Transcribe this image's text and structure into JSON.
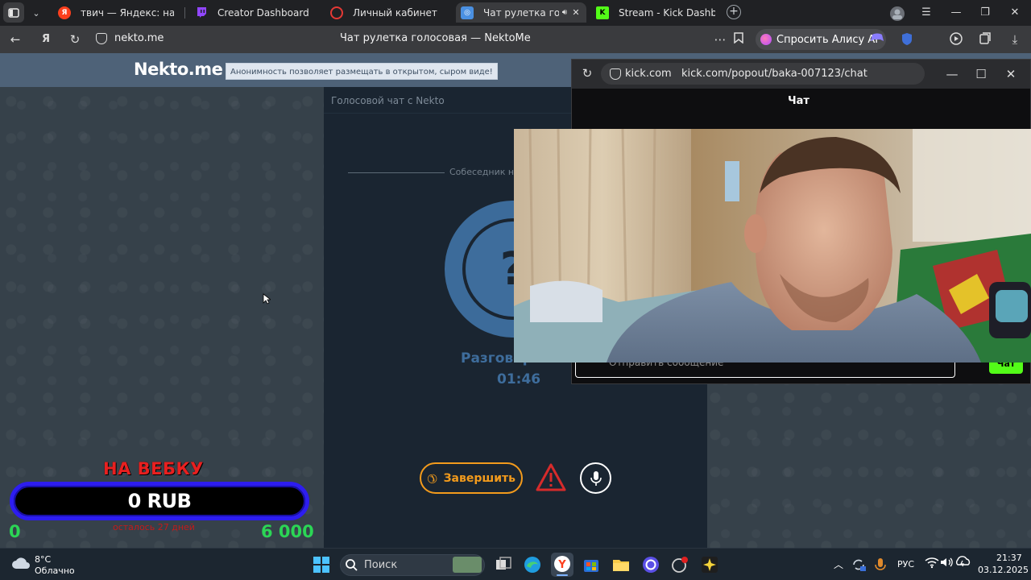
{
  "browser": {
    "tabs": [
      {
        "label": "твич — Яндекс: нашлось",
        "favicon": "yandex-icon",
        "color": "#fc3f1d"
      },
      {
        "label": "Creator Dashboard",
        "favicon": "twitch-icon",
        "color": "#9146ff"
      },
      {
        "label": "Личный кабинет",
        "favicon": "red-ring-icon",
        "color": "#e53935"
      },
      {
        "label": "Чат рулетка голосовая",
        "favicon": "nekto-icon",
        "color": "#4a90e2"
      },
      {
        "label": "Stream - Kick Dashboard",
        "favicon": "kick-icon",
        "color": "#53fc18"
      }
    ],
    "active_tab_index": 3,
    "address": "nekto.me",
    "page_title": "Чат рулетка голосовая — NektoMe",
    "alice_button": "Спросить Алису AI"
  },
  "nekto": {
    "logo": "Nekto.me",
    "slogan": "Анонимность позволяет размещать в открытом, сыром виде!",
    "panel_title": "Голосовой чат с Nekto",
    "searching_text": "Собеседник най",
    "avatar_glyph": "?",
    "conversation_label": "Разговор с соб",
    "timer": "01:46",
    "end_button": "Завершить"
  },
  "overlay": {
    "title": "НА ВЕБКУ",
    "amount": "0 RUB",
    "subtitle": "осталось 27 дней",
    "min": "0",
    "max": "6 000",
    "progress": 0
  },
  "kick_popout": {
    "host": "kick.com",
    "path": "kick.com/popout/baka-007123/chat",
    "chat_title": "Чат",
    "input_placeholder": "Отправить сообщение",
    "send_label": "Чат"
  },
  "taskbar": {
    "weather_temp": "8°C",
    "weather_desc": "Облачно",
    "search_label": "Поиск",
    "language": "РУС",
    "time": "21:37",
    "date": "03.12.2025"
  },
  "colors": {
    "nekto_header": "#4e6278",
    "nekto_accent": "#3e6d9c",
    "end_orange": "#f39b1c",
    "overlay_red": "#e82020",
    "overlay_blue": "#2d1df0",
    "overlay_green": "#2bd655",
    "kick_green": "#53fc18"
  }
}
